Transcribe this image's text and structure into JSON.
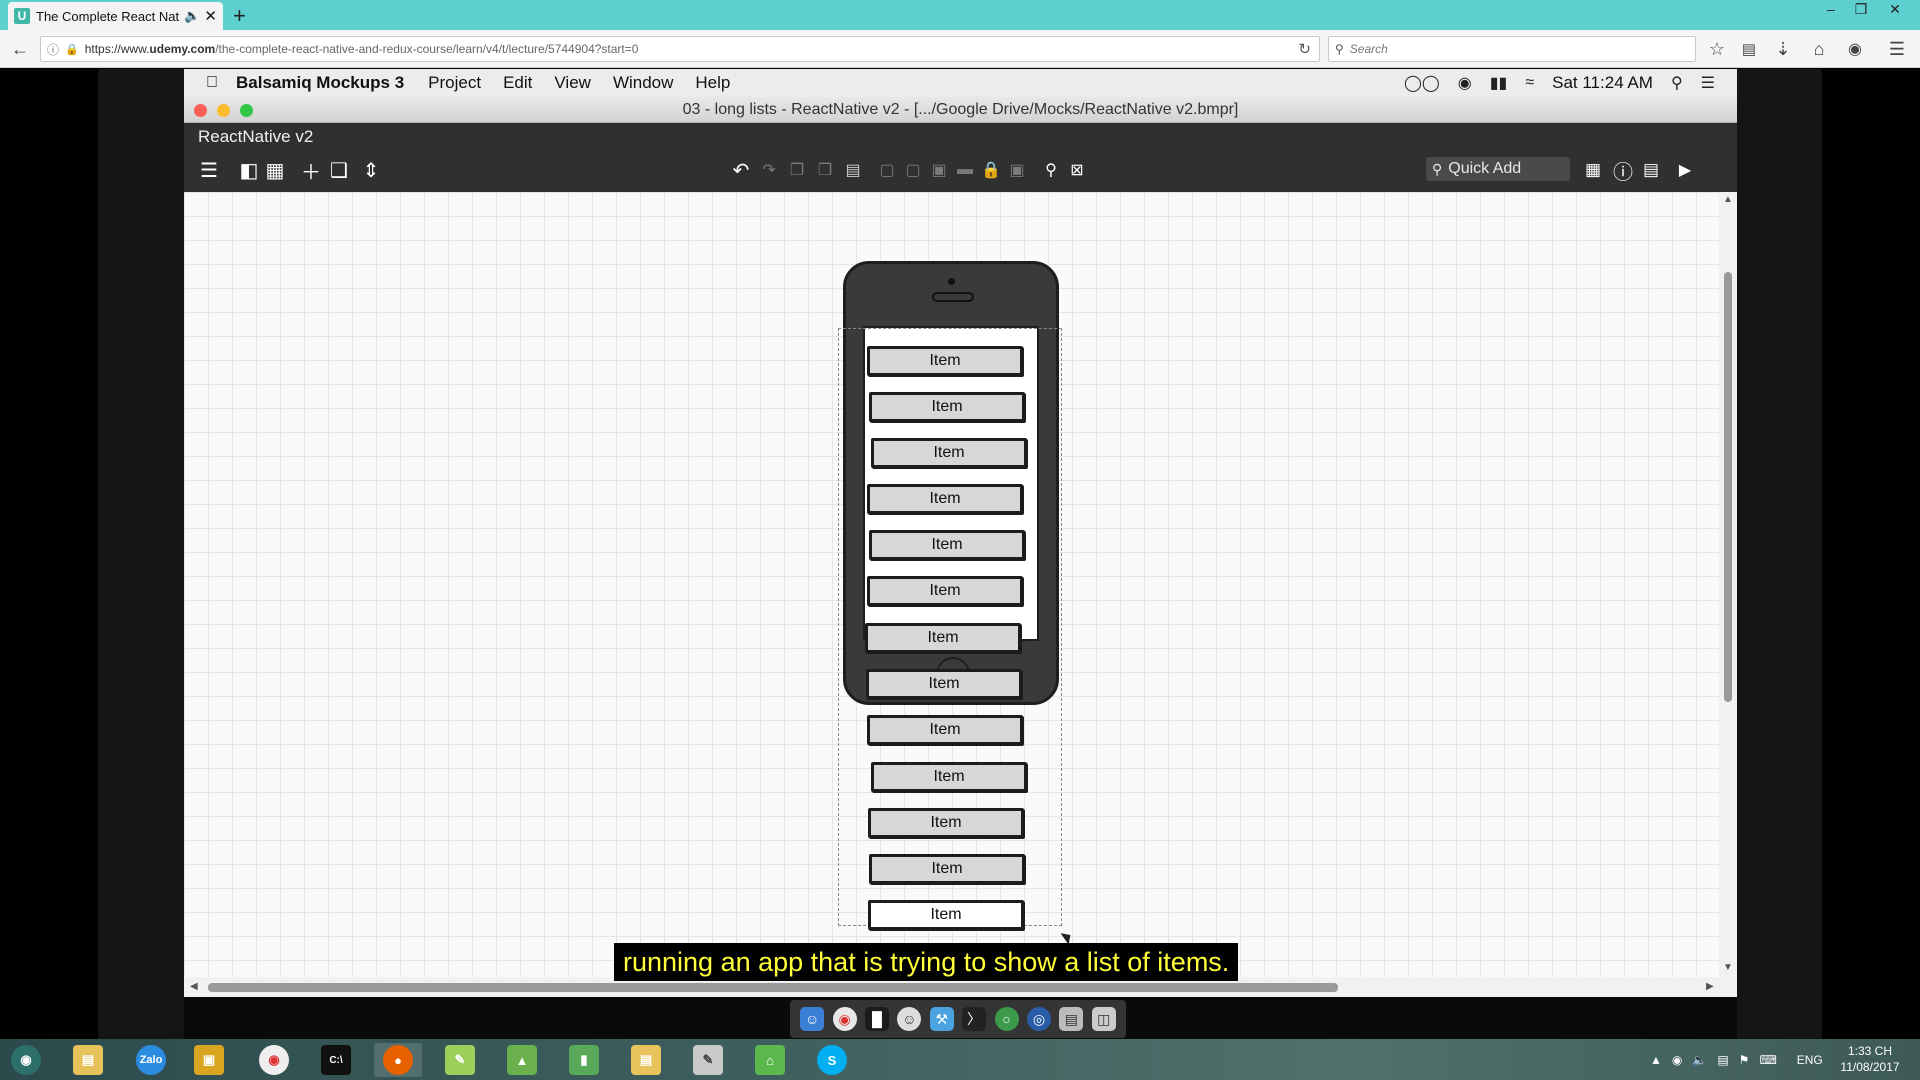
{
  "browser": {
    "tab_title": "The Complete React Nat",
    "tab_favicon": "U",
    "url_prefix": "https://www.",
    "url_domain": "udemy.com",
    "url_path": "/the-complete-react-native-and-redux-course/learn/v4/t/lecture/5744904?start=0",
    "search_placeholder": "Search",
    "new_tab_label": "+"
  },
  "mac_menubar": {
    "app_name": "Balsamiq Mockups 3",
    "menus": [
      "Project",
      "Edit",
      "View",
      "Window",
      "Help"
    ],
    "clock": "Sat 11:24 AM"
  },
  "balsamiq": {
    "window_title": "03 - long lists - ReactNative v2 - [.../Google Drive/Mocks/ReactNative v2.bmpr]",
    "project_name": "ReactNative v2",
    "quick_add_label": "Quick Add",
    "items": [
      "Item",
      "Item",
      "Item",
      "Item",
      "Item",
      "Item",
      "Item",
      "Item",
      "Item",
      "Item",
      "Item",
      "Item",
      "Item"
    ]
  },
  "subtitle": "running an app that is trying to show a list of items.",
  "taskbar": {
    "zalo_label": "Zalo",
    "lang": "ENG",
    "time": "1:33 CH",
    "date": "11/08/2017"
  },
  "colors": {
    "tabbar": "#5ecfcf",
    "subtitle_text": "#ffff3a",
    "traffic_red": "#fc5f57",
    "traffic_yellow": "#fdbc2e",
    "traffic_green": "#33c748"
  }
}
